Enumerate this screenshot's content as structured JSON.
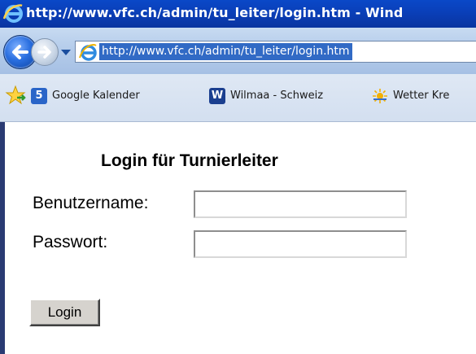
{
  "window": {
    "title": "http://www.vfc.ch/admin/tu_leiter/login.htm - Wind"
  },
  "navigation": {
    "address_url": "http://www.vfc.ch/admin/tu_leiter/login.htm"
  },
  "favorites": {
    "items": [
      {
        "label": "Google Kalender",
        "icon_text": "5",
        "icon": "calendar-icon"
      },
      {
        "label": "Wilmaa - Schweiz",
        "icon_text": "W",
        "icon": "wilmaa-icon"
      },
      {
        "label": "Wetter Kre",
        "icon_text": "",
        "icon": "weather-sun-icon"
      }
    ]
  },
  "form": {
    "heading": "Login für Turnierleiter",
    "username_label": "Benutzername:",
    "username_value": "",
    "password_label": "Passwort:",
    "password_value": "",
    "submit_label": "Login"
  },
  "colors": {
    "titlebar": "#0a48c8",
    "address_selection": "#316ac5",
    "button_face": "#d6d3ce"
  }
}
